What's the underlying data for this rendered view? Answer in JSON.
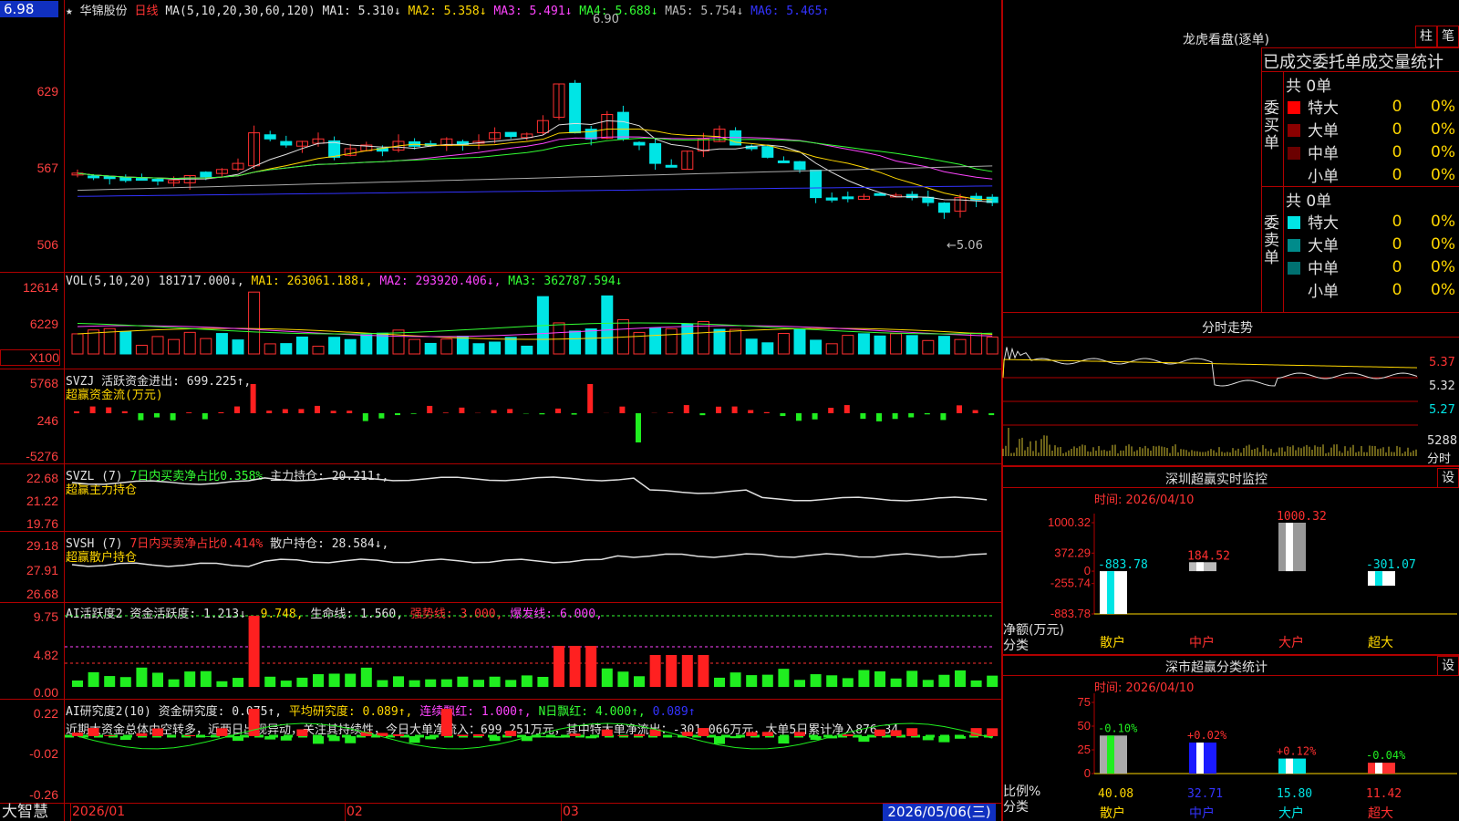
{
  "price_box": "6.98",
  "stock": {
    "star": "★",
    "name": "华锦股份",
    "period": "日线"
  },
  "kline_header": {
    "ma_def": "MA(5,10,20,30,60,120)",
    "items": [
      {
        "label": "MA1: 5.310↓",
        "color": "#e0e0e0"
      },
      {
        "label": "MA2: 5.358↓",
        "color": "#ffd700"
      },
      {
        "label": "MA3: 5.491↓",
        "color": "#ff44ff"
      },
      {
        "label": "MA4: 5.688↓",
        "color": "#33ff33"
      },
      {
        "label": "MA5: 5.754↓",
        "color": "#bbbbbb"
      },
      {
        "label": "MA6: 5.465↑",
        "color": "#3333ff"
      }
    ],
    "high_mark": "6.90",
    "low_mark": "←5.06"
  },
  "kline_axis": [
    "629",
    "567",
    "506"
  ],
  "vol_header": {
    "def": "VOL(5,10,20)",
    "v": "181717.000↓,",
    "ma1": "MA1: 263061.188↓,",
    "ma2": "MA2: 293920.406↓,",
    "ma3": "MA3: 362787.594↓"
  },
  "vol_axis": [
    "12614",
    "6229",
    "X100"
  ],
  "svzj": {
    "title": "SVZJ",
    "line1": "活跃资金进出: 699.225↑,",
    "line2": "超赢资金流(万元)",
    "axis": [
      "5768",
      "246",
      "-5276"
    ]
  },
  "svzl": {
    "title": "SVZL (7)",
    "a": "7日内买卖净占比0.358%",
    "b": "主力持仓: 20.211↑,",
    "line2": "超赢主力持仓",
    "axis": [
      "22.68",
      "21.22",
      "19.76"
    ]
  },
  "svsh": {
    "title": "SVSH (7)",
    "a": "7日内买卖净占比0.414%",
    "b": "散户持仓: 28.584↓,",
    "line2": "超赢散户持仓",
    "axis": [
      "29.18",
      "27.91",
      "26.68"
    ]
  },
  "ai1": {
    "title": "AI活跃度2",
    "a": "资金活跃度: 1.213↓,",
    "b": "9.748,",
    "c": "生命线: 1.560,",
    "d": "强势线: 3.000,",
    "e": "爆发线: 6.000,",
    "axis": [
      "9.75",
      "4.82",
      "0.00"
    ]
  },
  "ai2": {
    "title": "AI研究度2(10)",
    "a": "资金研究度: 0.075↑,",
    "b": "平均研究度: 0.089↑,",
    "c": "连续飘红: 1.000↑,",
    "d": "N日飘红: 4.000↑,",
    "e": "0.089↑",
    "note": "近期大资金总体由空转多，近两日出现异动，关注其持续性，今日大单净流入：699.251万元，其中特大单净流出：-301.066万元，大单5日累计净入876.34",
    "axis": [
      "0.22",
      "-0.02",
      "-0.26"
    ]
  },
  "dates": {
    "d1": "2026/01",
    "d2": "02",
    "d3": "03",
    "cur": "2026/05/06(三)"
  },
  "brand": "大智慧",
  "lhb": {
    "title": "龙虎看盘(逐单)",
    "tab1": "柱",
    "tab2": "笔",
    "sub": "已成交委托单成交量统计",
    "buy_label": "委买单",
    "sell_label": "委卖单",
    "total": "共 0单",
    "rows": [
      {
        "name": "特大",
        "n": "0",
        "p": "0%"
      },
      {
        "name": "大单",
        "n": "0",
        "p": "0%"
      },
      {
        "name": "中单",
        "n": "0",
        "p": "0%"
      },
      {
        "name": "小单",
        "n": "0",
        "p": "0%"
      }
    ],
    "buy_colors": [
      "#ff0000",
      "#8b0000",
      "#6b0000",
      "#000000"
    ],
    "sell_colors": [
      "#00e5e5",
      "#008b8b",
      "#007070",
      "#000000"
    ]
  },
  "fenshi": {
    "title": "分时走势",
    "axis": [
      "5.37",
      "5.32",
      "5.27"
    ],
    "vol": "5288",
    "unit": "分时"
  },
  "monitor": {
    "title": "深圳超赢实时监控",
    "btn": "设",
    "time": "时间: 2026/04/10",
    "axis": [
      "1000.32",
      "372.29",
      "0",
      "-255.74",
      "-883.78"
    ],
    "ylabel": "净额(万元)",
    "xlabel": "分类"
  },
  "classify": {
    "title": "深市超赢分类统计",
    "btn": "设",
    "time": "时间: 2026/04/10",
    "axis": [
      "75",
      "50",
      "25",
      "0"
    ],
    "ylabel": "比例%",
    "xlabel": "分类"
  },
  "chart_data": [
    {
      "type": "bar",
      "title": "深圳超赢实时监控",
      "categories": [
        "散户",
        "中户",
        "大户",
        "超大"
      ],
      "values": [
        -883.78,
        184.52,
        1000.32,
        -301.07
      ],
      "value_labels": [
        "-883.78",
        "184.52",
        "1000.32",
        "-301.07"
      ],
      "ylim": [
        -883.78,
        1000.32
      ],
      "ylabel": "净额(万元)",
      "xlabel": "分类"
    },
    {
      "type": "bar",
      "title": "深市超赢分类统计",
      "categories": [
        "散户",
        "中户",
        "大户",
        "超大"
      ],
      "values": [
        40.08,
        32.71,
        15.8,
        11.42
      ],
      "value_labels": [
        "40.08",
        "32.71",
        "15.80",
        "11.42"
      ],
      "changes": [
        "-0.10%",
        "+0.02%",
        "+0.12%",
        "-0.04%"
      ],
      "ylim": [
        0,
        75
      ],
      "ylabel": "比例%",
      "xlabel": "分类"
    }
  ]
}
